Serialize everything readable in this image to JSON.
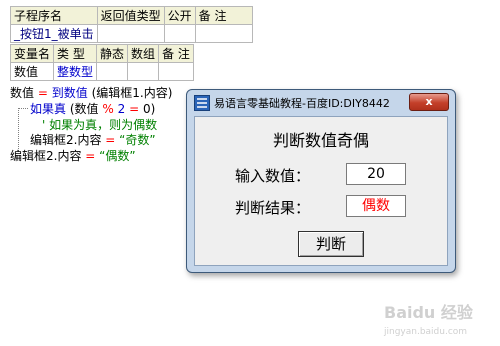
{
  "sub_table": {
    "headers": [
      "子程序名",
      "返回值类型",
      "公开",
      "备 注"
    ],
    "row": [
      "_按钮1_被单击",
      "",
      "",
      ""
    ]
  },
  "var_table": {
    "headers": [
      "变量名",
      "类 型",
      "静态",
      "数组",
      "备 注"
    ],
    "row": [
      "数值",
      "整数型",
      "",
      "",
      ""
    ]
  },
  "code": {
    "line1": {
      "var": "数值",
      "eq": "=",
      "func": "到数值",
      "arg": "(编辑框1.内容)"
    },
    "line2": {
      "kw": "如果真",
      "open": "(数值",
      "op": "%",
      "num": "2",
      "eq": "=",
      "close": "0)"
    },
    "line3": {
      "comment": "' 如果为真，则为偶数"
    },
    "line4": {
      "target": "编辑框2.内容",
      "eq": "=",
      "str": "“奇数”"
    },
    "line5": {
      "target": "编辑框2.内容",
      "eq": "=",
      "str": "“偶数”"
    }
  },
  "window": {
    "title": "易语言零基础教程-百度ID:DIY8442",
    "close_glyph": "x",
    "heading": "判断数值奇偶",
    "input_label": "输入数值：",
    "input_value": "20",
    "result_label": "判断结果：",
    "result_value": "偶数",
    "button_label": "判断"
  },
  "watermark": {
    "text": "Baidu 经验",
    "url": "jingyan.baidu.com"
  }
}
